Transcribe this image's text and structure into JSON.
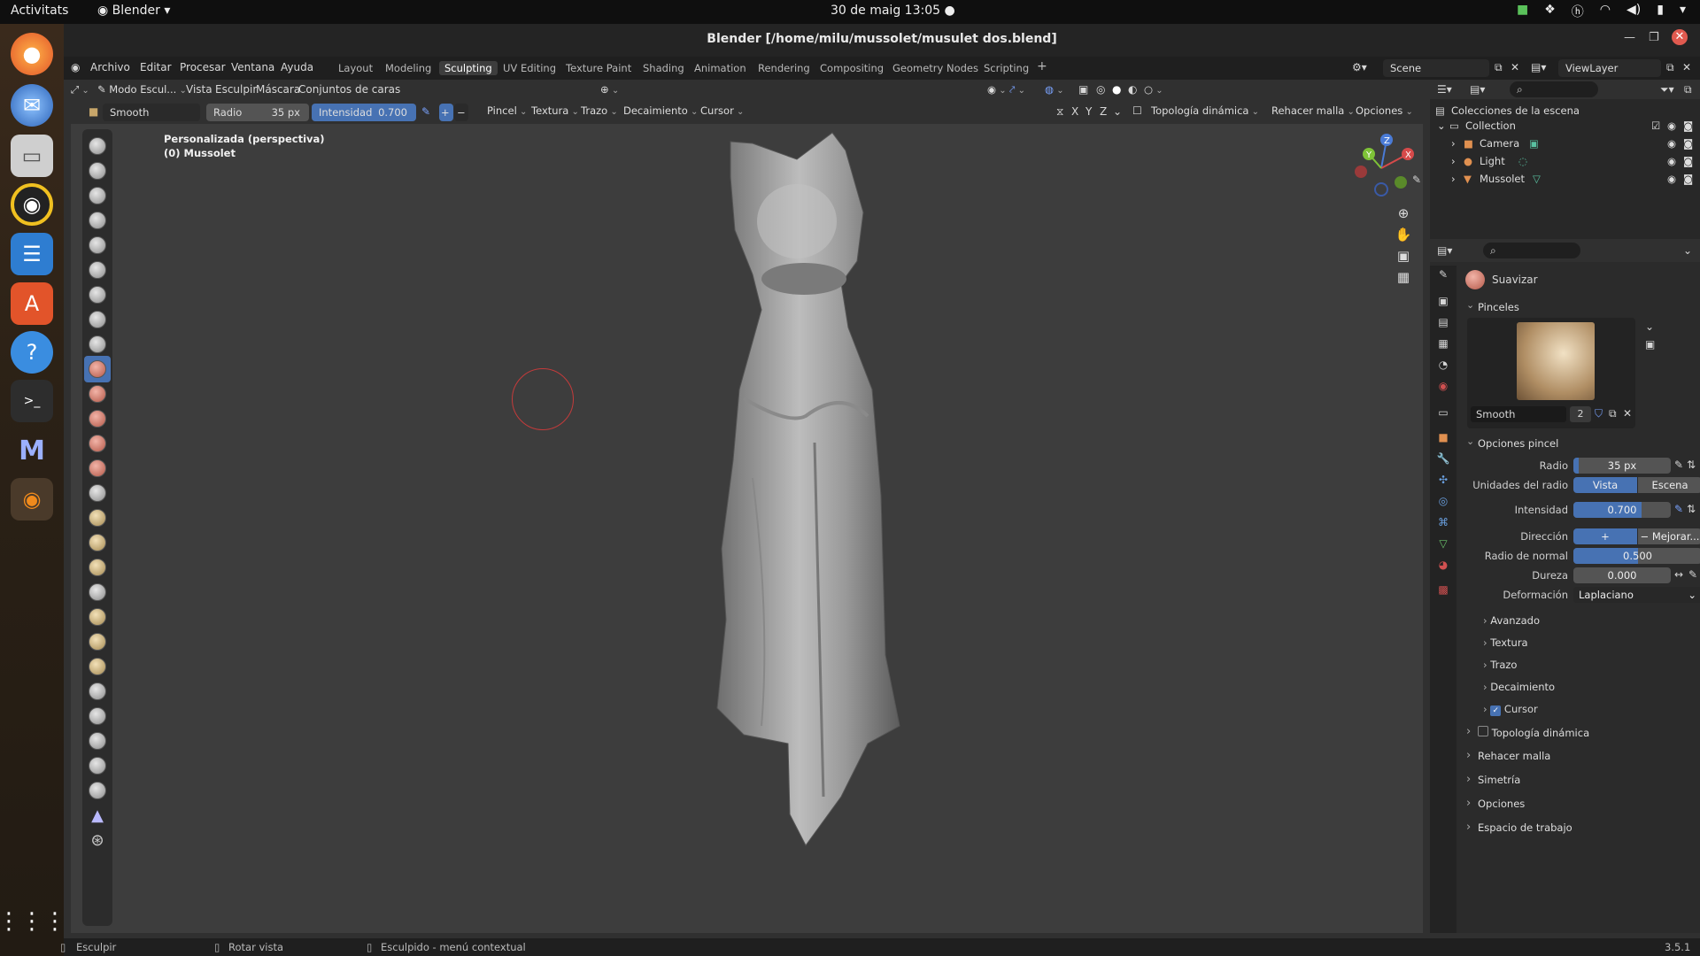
{
  "gnome": {
    "activities": "Activitats",
    "app_menu": "Blender",
    "clock": "30 de maig  13:05"
  },
  "window": {
    "title": "Blender [/home/milu/mussolet/musulet dos.blend]"
  },
  "menu": {
    "items": [
      "Archivo",
      "Editar",
      "Procesar",
      "Ventana",
      "Ayuda"
    ]
  },
  "workspaces": {
    "tabs": [
      "Layout",
      "Modeling",
      "Sculpting",
      "UV Editing",
      "Texture Paint",
      "Shading",
      "Animation",
      "Rendering",
      "Compositing",
      "Geometry Nodes",
      "Scripting"
    ],
    "active": "Sculpting",
    "scene": "Scene",
    "view_layer": "ViewLayer"
  },
  "viewport_header": {
    "mode": "Modo Escul...",
    "menus": [
      "Vista",
      "Esculpir",
      "Máscara",
      "Conjuntos de caras"
    ]
  },
  "tool_header": {
    "brush_name": "Smooth",
    "radius_label": "Radio",
    "radius_value": "35 px",
    "strength_label": "Intensidad",
    "strength_value": "0.700",
    "dropdowns": [
      "Pincel",
      "Textura",
      "Trazo",
      "Decaimiento",
      "Cursor"
    ],
    "axes": [
      "X",
      "Y",
      "Z"
    ],
    "dyntopo": "Topología dinámica",
    "remesh": "Rehacer malla",
    "options": "Opciones"
  },
  "viewport": {
    "view_name": "Personalizada (perspectiva)",
    "object_name": "(0) Mussolet",
    "gizmo_axes": [
      "X",
      "Y",
      "Z"
    ]
  },
  "outliner": {
    "root": "Colecciones de la escena",
    "collection": "Collection",
    "objects": [
      "Camera",
      "Light",
      "Mussolet"
    ]
  },
  "properties": {
    "tool_name": "Suavizar",
    "brushes_panel": "Pinceles",
    "brush_name": "Smooth",
    "brush_users": "2",
    "brush_options_panel": "Opciones pincel",
    "radius_label": "Radio",
    "radius_value": "35 px",
    "radius_units_label": "Unidades del radio",
    "radius_units": [
      "Vista",
      "Escena"
    ],
    "strength_label": "Intensidad",
    "strength_value": "0.700",
    "strength_fraction": 0.7,
    "direction_label": "Dirección",
    "direction_options": [
      "+ Suavizado",
      "− Mejorar..."
    ],
    "normal_radius_label": "Radio de normal",
    "normal_radius_value": "0.500",
    "normal_radius_fraction": 0.5,
    "hardness_label": "Dureza",
    "hardness_value": "0.000",
    "deformation_label": "Deformación",
    "deformation_value": "Laplaciano",
    "subpanels": [
      "Avanzado",
      "Textura",
      "Trazo",
      "Decaimiento",
      "Cursor"
    ],
    "panels": [
      "Topología dinámica",
      "Rehacer malla",
      "Simetría",
      "Opciones",
      "Espacio de trabajo"
    ]
  },
  "statusbar": {
    "left": "Esculpir",
    "middle": "Rotar vista",
    "right": "Esculpido - menú contextual",
    "version": "3.5.1"
  },
  "colors": {
    "accent": "#4772b3",
    "viewport_bg": "#3d3d3d",
    "brush_cursor": "#c43b3b"
  }
}
